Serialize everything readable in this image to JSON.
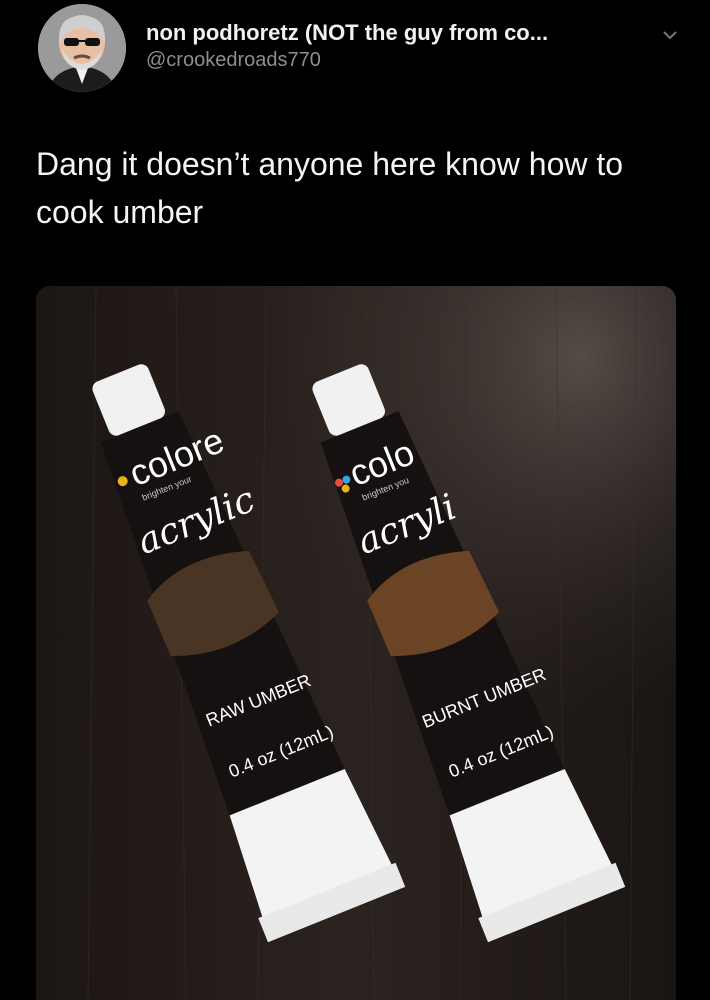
{
  "tweet": {
    "display_name": "non podhoretz (NOT the guy from co...",
    "handle": "@crookedroads770",
    "text": "Dang it doesn’t anyone here know how to cook umber"
  },
  "photo": {
    "tube_left": {
      "brand": "colore",
      "tagline": "brighten your",
      "type": "acrylic",
      "color_name": "RAW UMBER",
      "size": "0.4 oz (12mL)",
      "paint_color": "#4a3524"
    },
    "tube_right": {
      "brand": "colo",
      "tagline": "brighten you",
      "type": "acryli",
      "color_name": "BURNT UMBER",
      "size": "0.4 oz (12mL)",
      "paint_color": "#6b4425"
    }
  },
  "colors": {
    "background": "#000000",
    "text": "#f4f4f4",
    "handle": "#8e8e8e"
  }
}
